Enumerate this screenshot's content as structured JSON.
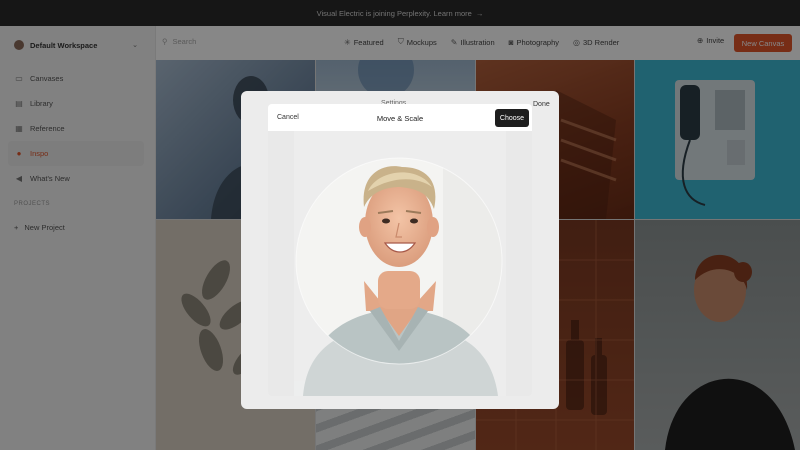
{
  "banner": {
    "text": "Visual Electric is joining Perplexity. Learn more",
    "arrow": "→"
  },
  "sidebar": {
    "workspace": "Default Workspace",
    "items": [
      {
        "label": "Canvases",
        "icon": "canvases-icon",
        "glyph": "▭"
      },
      {
        "label": "Library",
        "icon": "library-icon",
        "glyph": "▤"
      },
      {
        "label": "Reference",
        "icon": "reference-icon",
        "glyph": "▦"
      },
      {
        "label": "Inspo",
        "icon": "inspo-icon",
        "glyph": "●",
        "active": true
      },
      {
        "label": "What's New",
        "icon": "megaphone-icon",
        "glyph": "◀"
      }
    ],
    "projects_label": "PROJECTS",
    "new_project": "New Project"
  },
  "header": {
    "search_placeholder": "Search",
    "categories": [
      {
        "label": "Featured",
        "glyph": "✳"
      },
      {
        "label": "Mockups",
        "glyph": "⛉"
      },
      {
        "label": "Illustration",
        "glyph": "✎"
      },
      {
        "label": "Photography",
        "glyph": "◙"
      },
      {
        "label": "3D Render",
        "glyph": "◎"
      }
    ],
    "invite": "Invite",
    "new_button": "New Canvas"
  },
  "panel": {
    "title": "Settings",
    "done": "Done"
  },
  "dialog": {
    "cancel": "Cancel",
    "title": "Move & Scale",
    "choose": "Choose"
  },
  "colors": {
    "accent": "#e0552b",
    "banner_bg": "#2b2b2b"
  }
}
